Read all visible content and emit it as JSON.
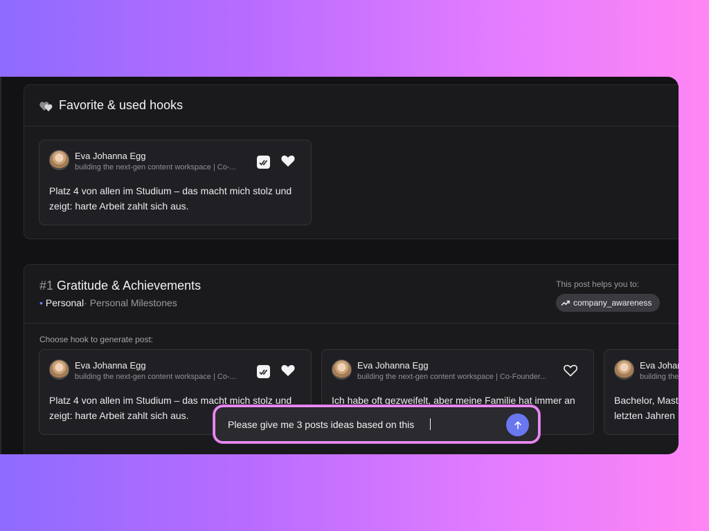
{
  "favorites": {
    "title": "Favorite & used hooks",
    "card": {
      "author": "Eva Johanna Egg",
      "bio": "building the next-gen content workspace | Co-...",
      "text": "Platz 4 von allen im Studium – das macht mich stolz und zeigt: harte Arbeit zahlt sich aus."
    }
  },
  "post": {
    "number": "#1",
    "title": "Gratitude & Achievements",
    "category": "Personal",
    "subcategory": "· Personal Milestones",
    "helps_label": "This post helps you to:",
    "tag": "company_awareness",
    "choose_label": "Choose hook to generate post:",
    "hooks": [
      {
        "author": "Eva Johanna Egg",
        "bio": "building the next-gen content workspace | Co-...",
        "text": "Platz 4 von allen im Studium – das macht mich stolz und zeigt: harte Arbeit zahlt sich aus."
      },
      {
        "author": "Eva Johanna Egg",
        "bio": "building the next-gen content workspace | Co-Founder...",
        "text": "Ich habe oft gezweifelt, aber meine Familie hat immer an"
      },
      {
        "author": "Eva Johar",
        "bio": "building the",
        "text": "Bachelor, Mast letzten Jahren"
      }
    ]
  },
  "chat": {
    "value": "Please give me 3 posts ideas based on this",
    "send_icon": "arrow-up-icon",
    "border_color": "#e98cf3"
  },
  "colors": {
    "accent": "#6a77f0",
    "background_gradient_start": "#8f6bff",
    "background_gradient_end": "#ff86f4"
  }
}
